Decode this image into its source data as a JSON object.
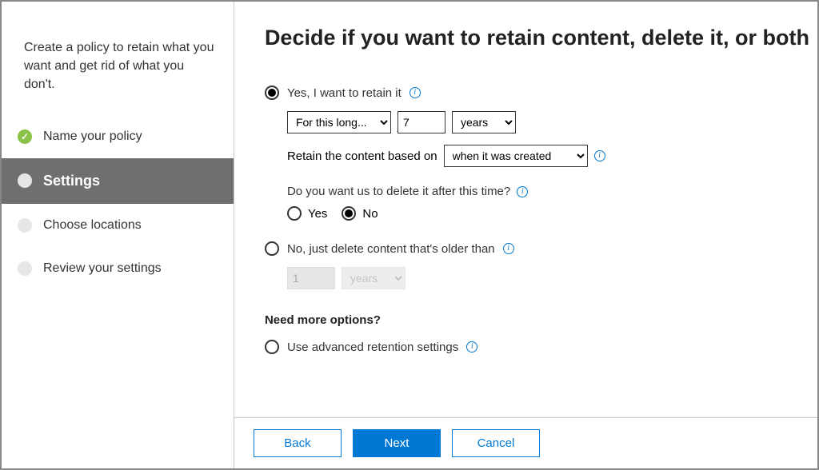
{
  "sidebar": {
    "description": "Create a policy to retain what you want and get rid of what you don't.",
    "steps": [
      {
        "label": "Name your policy",
        "state": "done"
      },
      {
        "label": "Settings",
        "state": "active"
      },
      {
        "label": "Choose locations",
        "state": "pending"
      },
      {
        "label": "Review your settings",
        "state": "pending"
      }
    ]
  },
  "main": {
    "title": "Decide if you want to retain content, delete it, or both",
    "retain": {
      "label": "Yes, I want to retain it",
      "selected": true,
      "duration_type_options": [
        "For this long..."
      ],
      "duration_type_value": "For this long...",
      "duration_number": "7",
      "duration_unit_options": [
        "years"
      ],
      "duration_unit_value": "years",
      "based_on_label": "Retain the content based on",
      "based_on_options": [
        "when it was created"
      ],
      "based_on_value": "when it was created",
      "delete_question": "Do you want us to delete it after this time?",
      "yes_label": "Yes",
      "no_label": "No",
      "delete_after_selected": "No"
    },
    "delete_only": {
      "label": "No, just delete content that's older than",
      "selected": false,
      "disabled_number": "1",
      "disabled_unit": "years"
    },
    "more_options": {
      "heading": "Need more options?",
      "advanced_label": "Use advanced retention settings",
      "advanced_selected": false
    }
  },
  "footer": {
    "back": "Back",
    "next": "Next",
    "cancel": "Cancel"
  }
}
